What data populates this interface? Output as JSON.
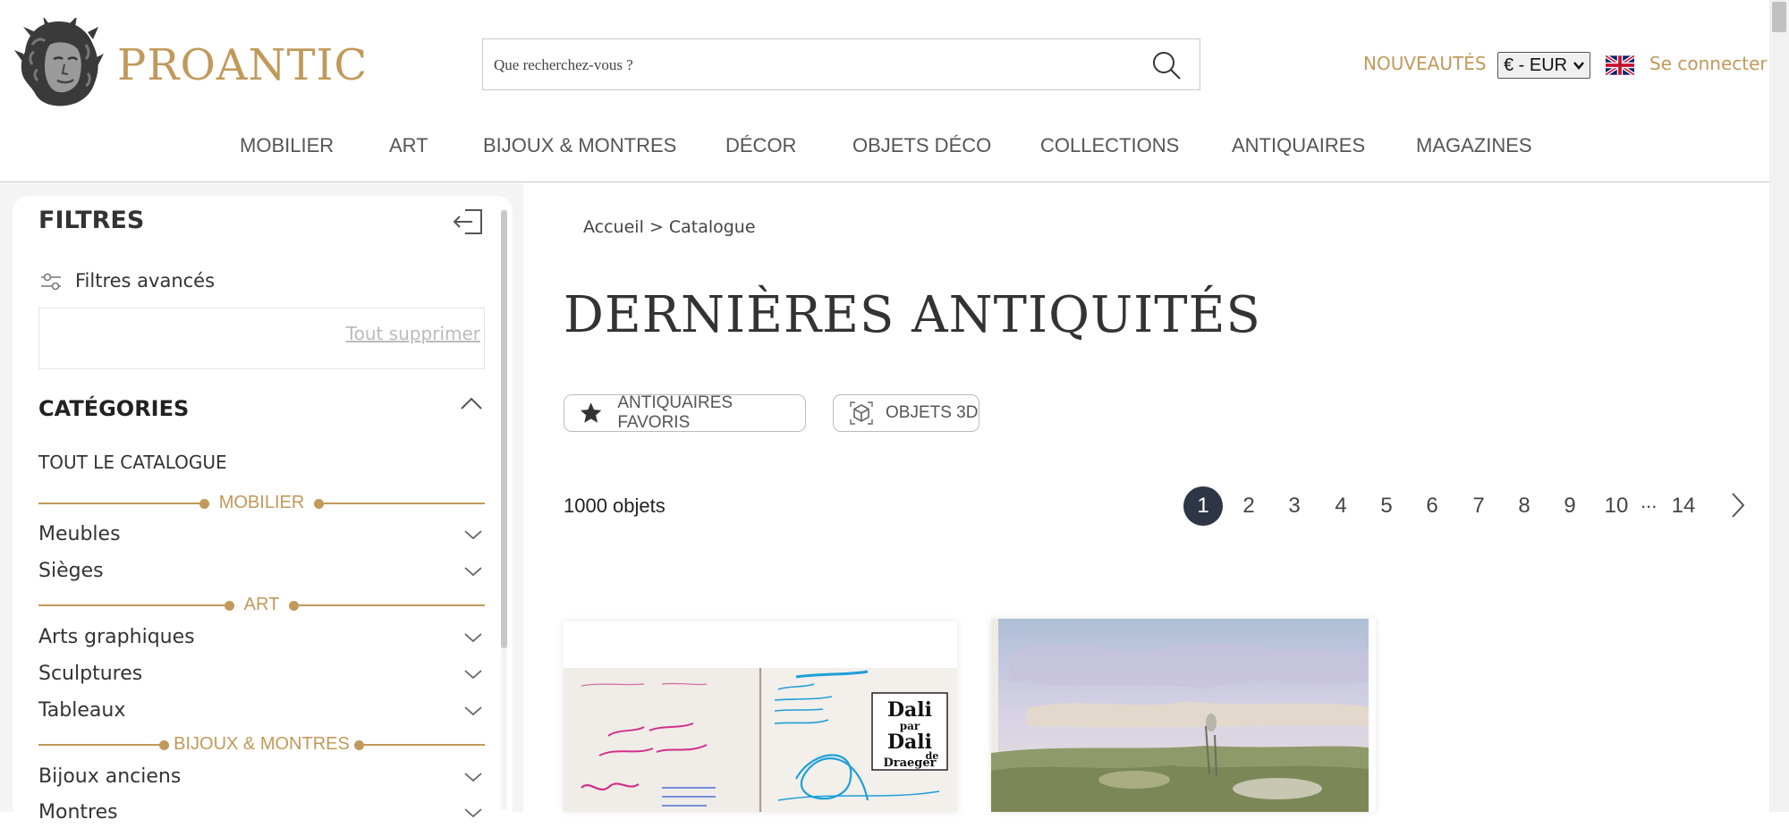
{
  "header": {
    "logo_text": "PROANTIC",
    "search_placeholder": "Que recherchez-vous ?",
    "nouveautes": "NOUVEAUTÉS",
    "currency": "€ - EUR",
    "login": "Se connecter"
  },
  "nav": {
    "items": [
      "MOBILIER",
      "ART",
      "BIJOUX & MONTRES",
      "DÉCOR",
      "OBJETS DÉCO",
      "COLLECTIONS",
      "ANTIQUAIRES",
      "MAGAZINES"
    ]
  },
  "sidebar": {
    "title": "FILTRES",
    "advanced": "Filtres avancés",
    "clear_all": "Tout supprimer",
    "categories_title": "CATÉGORIES",
    "all_catalog": "TOUT LE CATALOGUE",
    "groups": [
      {
        "label": "MOBILIER",
        "items": [
          "Meubles",
          "Sièges"
        ]
      },
      {
        "label": "ART",
        "items": [
          "Arts graphiques",
          "Sculptures",
          "Tableaux"
        ]
      },
      {
        "label": "BIJOUX & MONTRES",
        "items": [
          "Bijoux anciens",
          "Montres"
        ]
      }
    ]
  },
  "main": {
    "breadcrumb": "Accueil > Catalogue",
    "title": "DERNIÈRES ANTIQUITÉS",
    "chips": [
      "ANTIQUAIRES FAVORIS",
      "OBJETS 3D"
    ],
    "count": "1000 objets",
    "pages": [
      "1",
      "2",
      "3",
      "4",
      "5",
      "6",
      "7",
      "8",
      "9",
      "10",
      "14"
    ],
    "ellipsis": "...",
    "current_page": "1"
  },
  "products": {
    "card1_text": {
      "dali_line1": "Dali",
      "dali_par": "par",
      "dali_line2": "Dali",
      "dali_de": "de",
      "dali_line3": "Draeger"
    }
  },
  "colors": {
    "brand_gold": "#c1995a",
    "pagination_active": "#2e3544"
  }
}
